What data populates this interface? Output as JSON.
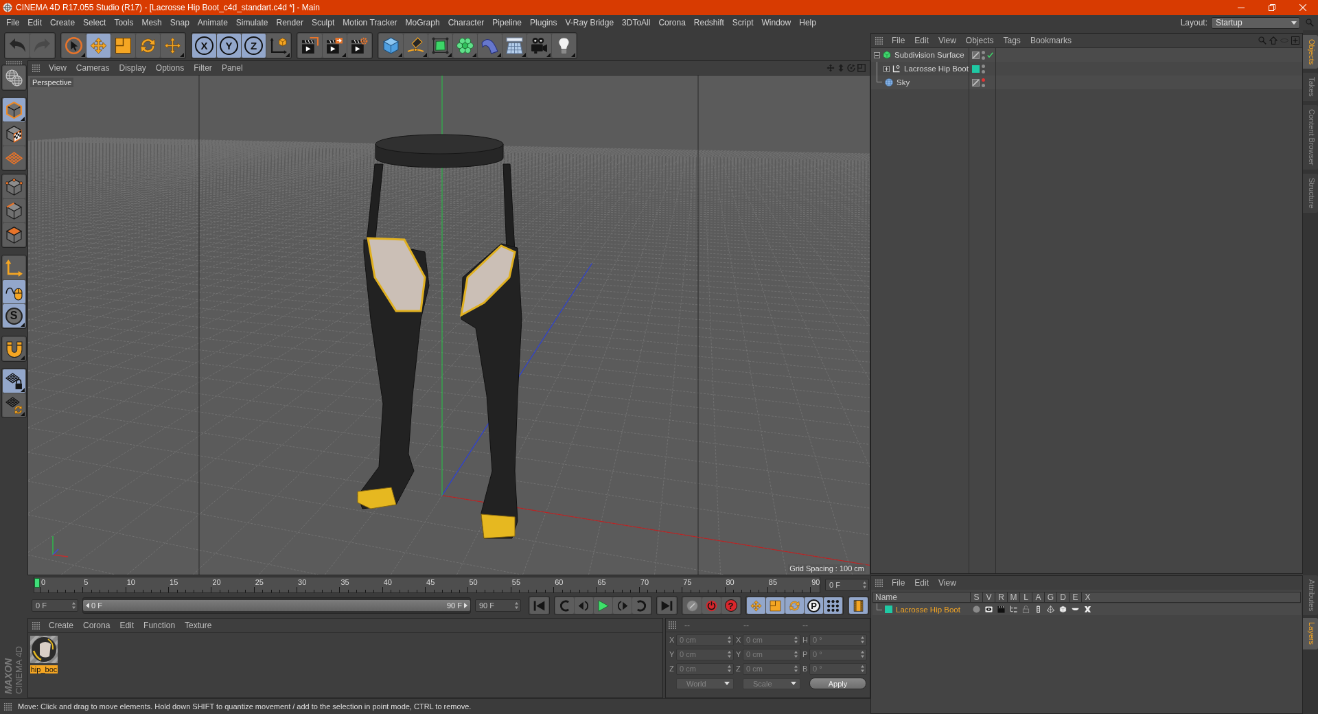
{
  "window": {
    "title": "CINEMA 4D R17.055 Studio (R17) - [Lacrosse Hip Boot_c4d_standart.c4d *] - Main"
  },
  "menu_bar": {
    "items": [
      "File",
      "Edit",
      "Create",
      "Select",
      "Tools",
      "Mesh",
      "Snap",
      "Animate",
      "Simulate",
      "Render",
      "Sculpt",
      "Motion Tracker",
      "MoGraph",
      "Character",
      "Pipeline",
      "Plugins",
      "V-Ray Bridge",
      "3DToAll",
      "Corona",
      "Redshift",
      "Script",
      "Window",
      "Help"
    ],
    "layout_label": "Layout:",
    "layout_value": "Startup"
  },
  "toolbar": {
    "groups": [
      [
        {
          "selected": false,
          "disabled": false
        },
        {
          "selected": false,
          "disabled": true
        }
      ],
      [
        {
          "selected": false
        },
        {
          "selected": true
        },
        {
          "selected": false
        },
        {
          "selected": false
        },
        {
          "selected": false
        }
      ],
      [
        {
          "label": "X",
          "selected": true
        },
        {
          "label": "Y",
          "selected": true
        },
        {
          "label": "Z",
          "selected": true
        },
        {
          "selected": false
        }
      ],
      [
        {
          "selected": false
        },
        {
          "selected": false
        },
        {
          "selected": false
        }
      ],
      [
        {
          "selected": false
        },
        {
          "selected": false
        },
        {
          "selected": false
        },
        {
          "selected": false
        },
        {
          "selected": false
        },
        {
          "selected": false
        },
        {
          "selected": false
        },
        {
          "selected": false
        }
      ]
    ]
  },
  "left_toolbar": {
    "groups": [
      [
        {
          "selected": false
        }
      ],
      [
        {
          "selected": true
        },
        {
          "selected": false
        },
        {
          "selected": false
        }
      ],
      [
        {
          "selected": false
        },
        {
          "selected": false
        },
        {
          "selected": false
        }
      ],
      [
        {
          "selected": false
        },
        {
          "selected": true
        },
        {
          "label": "S",
          "selected": true
        }
      ],
      [
        {
          "selected": false
        }
      ],
      [
        {
          "selected": true
        },
        {
          "selected": false
        }
      ]
    ],
    "brand": {
      "company": "MAXON",
      "product": "CINEMA 4D"
    }
  },
  "viewport": {
    "menu": [
      "View",
      "Cameras",
      "Display",
      "Options",
      "Filter",
      "Panel"
    ],
    "camera": "Perspective",
    "grid_spacing": "Grid Spacing : 100 cm"
  },
  "timeline": {
    "frame_labels": [
      "0",
      "5",
      "10",
      "15",
      "20",
      "25",
      "30",
      "35",
      "40",
      "45",
      "50",
      "55",
      "60",
      "65",
      "70",
      "75",
      "80",
      "85",
      "90"
    ],
    "level": 0,
    "current_frame": "0 F",
    "start_frame": "0 F",
    "range": {
      "level": 1,
      "start": "0 F",
      "end": "90 F"
    },
    "end_frame": "90 F",
    "transport": [
      [
        {
          "selected": false
        }
      ],
      [
        {
          "selected": false
        },
        {
          "selected": false
        },
        {
          "selected": false
        },
        {
          "selected": false
        },
        {
          "selected": false
        }
      ],
      [
        {
          "selected": false
        }
      ],
      [
        {
          "selected": false
        },
        {
          "selected": false
        },
        {
          "label": "?",
          "selected": false
        }
      ],
      [
        {
          "selected": true
        },
        {
          "selected": true
        },
        {
          "selected": true
        },
        {
          "label": "P",
          "selected": true
        },
        {
          "selected": true
        }
      ],
      [
        {
          "selected": true
        }
      ]
    ]
  },
  "material_manager": {
    "menu": [
      "Create",
      "Corona",
      "Edit",
      "Function",
      "Texture"
    ],
    "materials": [
      {
        "name": "hip_boc",
        "selected": true
      }
    ]
  },
  "coordinates": {
    "headers": [
      "--",
      "--",
      "--"
    ],
    "rows": [
      {
        "position_axis": "X",
        "position": "0 cm",
        "size_axis": "X",
        "size": "0 cm",
        "rotation_axis": "H",
        "rotation": "0 °"
      },
      {
        "position_axis": "Y",
        "position": "0 cm",
        "size_axis": "Y",
        "size": "0 cm",
        "rotation_axis": "P",
        "rotation": "0 °"
      },
      {
        "position_axis": "Z",
        "position": "0 cm",
        "size_axis": "Z",
        "size": "0 cm",
        "rotation_axis": "B",
        "rotation": "0 °"
      }
    ],
    "coordinate_system": "World",
    "size_mode": "Scale",
    "apply": "Apply"
  },
  "status_bar": {
    "text": "Move: Click and drag to move elements. Hold down SHIFT to quantize movement / add to the selection in point mode, CTRL to remove."
  },
  "object_manager": {
    "menu": [
      "File",
      "Edit",
      "View",
      "Objects",
      "Tags",
      "Bookmarks"
    ],
    "objects": [
      {
        "name": "Subdivision Surface",
        "kind": "generator",
        "expanded": true,
        "dots": [
          {
            "color": "#8c8c8c"
          },
          {
            "color": "#8c8c8c"
          }
        ],
        "enabled": true,
        "children": [
          {
            "name": "Lacrosse Hip Boot",
            "kind": "null",
            "expanded": false,
            "color": "#1fc9a4",
            "dots": [
              {
                "color": "#8c8c8c"
              },
              {
                "color": "#8c8c8c"
              }
            ]
          }
        ]
      },
      {
        "name": "Sky",
        "kind": "sky",
        "dots": [
          {
            "color": "#e03535"
          },
          {
            "color": "#8c8c8c"
          }
        ]
      }
    ]
  },
  "layer_manager": {
    "menu": [
      "File",
      "Edit",
      "View"
    ],
    "columns": [
      "Name",
      "S",
      "V",
      "R",
      "M",
      "L",
      "A",
      "G",
      "D",
      "E",
      "X"
    ],
    "layers": [
      {
        "name": "Lacrosse Hip Boot",
        "color": "#1fc9a4",
        "selected": true,
        "switches": [
          false,
          true,
          true,
          true,
          false,
          true,
          true,
          true,
          true,
          true
        ]
      }
    ]
  },
  "side_tabs": {
    "top": [
      {
        "label": "Objects",
        "selected": true
      },
      {
        "label": "Takes",
        "selected": false
      },
      {
        "label": "Content Browser",
        "selected": false
      },
      {
        "label": "Structure",
        "selected": false
      }
    ],
    "bottom": [
      {
        "label": "Attributes",
        "selected": false
      },
      {
        "label": "Layers",
        "selected": true
      }
    ]
  }
}
